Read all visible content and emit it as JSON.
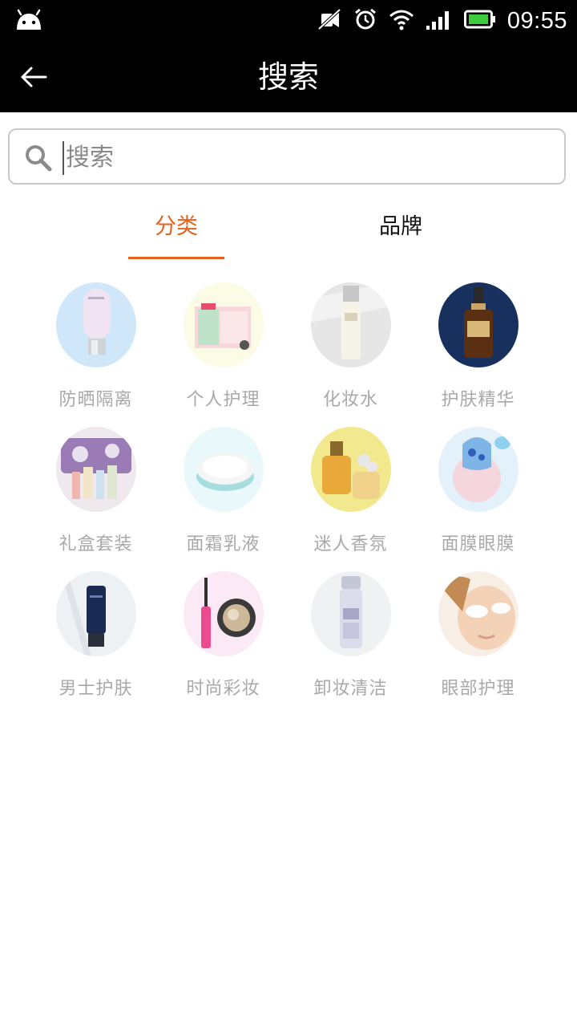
{
  "status_bar": {
    "time": "09:55",
    "icons": [
      "android-icon",
      "mute-icon",
      "alarm-icon",
      "wifi-icon",
      "signal-icon",
      "battery-icon"
    ]
  },
  "header": {
    "title": "搜索",
    "back_icon": "back-arrow-icon"
  },
  "search": {
    "placeholder": "搜索",
    "value": ""
  },
  "tabs": [
    {
      "label": "分类",
      "active": true
    },
    {
      "label": "品牌",
      "active": false
    }
  ],
  "colors": {
    "accent": "#e8601c",
    "bar_bg": "#000000",
    "label_gray": "#a9a9a9"
  },
  "categories": [
    {
      "label": "防晒隔离"
    },
    {
      "label": "个人护理"
    },
    {
      "label": "化妆水"
    },
    {
      "label": "护肤精华"
    },
    {
      "label": "礼盒套装"
    },
    {
      "label": "面霜乳液"
    },
    {
      "label": "迷人香氛"
    },
    {
      "label": "面膜眼膜"
    },
    {
      "label": "男士护肤"
    },
    {
      "label": "时尚彩妆"
    },
    {
      "label": "卸妆清洁"
    },
    {
      "label": "眼部护理"
    }
  ]
}
